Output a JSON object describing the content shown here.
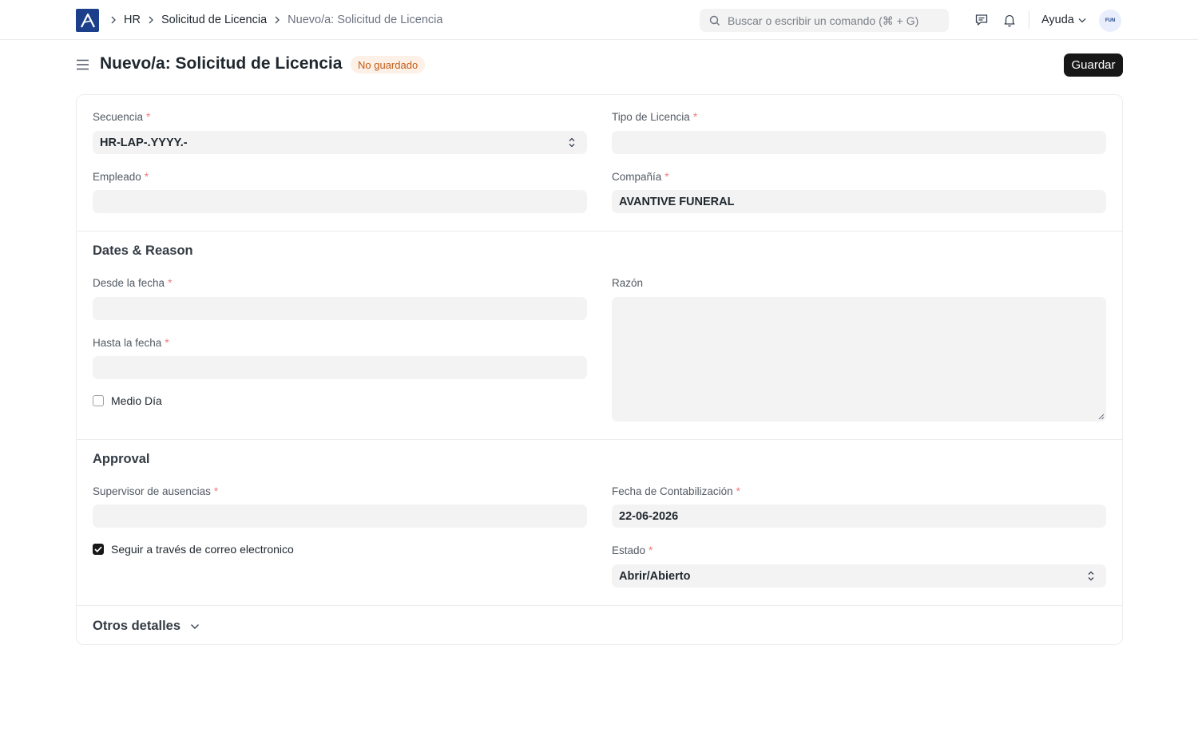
{
  "navbar": {
    "breadcrumbs": [
      "HR",
      "Solicitud de Licencia",
      "Nuevo/a: Solicitud de Licencia"
    ],
    "search_placeholder": "Buscar o escribir un comando (⌘ + G)",
    "help_label": "Ayuda",
    "avatar_initials": "FUN"
  },
  "page": {
    "title": "Nuevo/a: Solicitud de Licencia",
    "status_badge": "No guardado",
    "save_label": "Guardar"
  },
  "form": {
    "naming_series": {
      "label": "Secuencia",
      "value": "HR-LAP-.YYYY.-"
    },
    "leave_type": {
      "label": "Tipo de Licencia",
      "value": ""
    },
    "employee": {
      "label": "Empleado",
      "value": ""
    },
    "company": {
      "label": "Compañía",
      "value": "AVANTIVE FUNERAL"
    },
    "dates_section": {
      "title": "Dates & Reason",
      "from_date": {
        "label": "Desde la fecha",
        "value": ""
      },
      "to_date": {
        "label": "Hasta la fecha",
        "value": ""
      },
      "half_day": {
        "label": "Medio Día",
        "checked": false
      },
      "reason": {
        "label": "Razón",
        "value": ""
      }
    },
    "approval_section": {
      "title": "Approval",
      "leave_approver": {
        "label": "Supervisor de ausencias",
        "value": ""
      },
      "follow_email": {
        "label": "Seguir a través de correo electronico",
        "checked": true
      },
      "posting_date": {
        "label": "Fecha de Contabilización",
        "value": "22-06-2026"
      },
      "status": {
        "label": "Estado",
        "value": "Abrir/Abierto"
      }
    },
    "other_section": {
      "title": "Otros detalles"
    }
  },
  "colors": {
    "brand": "#1b3f8a",
    "primary_button": "#171717",
    "badge_bg": "#fdf0e6",
    "badge_text": "#c25c16",
    "required_mark": "#f27b7b",
    "field_bg": "#f3f3f3"
  }
}
